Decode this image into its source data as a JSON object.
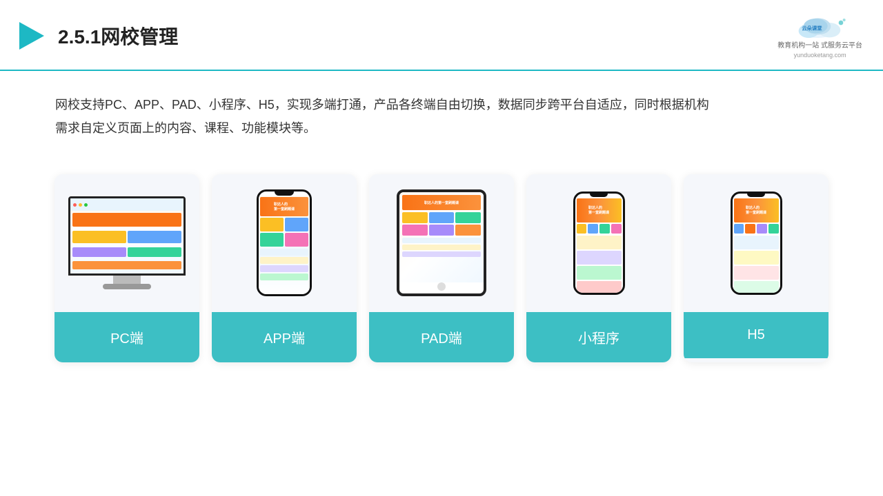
{
  "header": {
    "title": "2.5.1网校管理",
    "logo_name": "云朵课堂",
    "logo_sub": "教育机构一站\n式服务云平台",
    "logo_url": "yunduoketang.com"
  },
  "description": {
    "text": "网校支持PC、APP、PAD、小程序、H5，实现多端打通，产品各终端自由切换，数据同步跨平台自适应，同时根据机构需求自定义页面上的内容、课程、功能模块等。"
  },
  "cards": [
    {
      "id": "pc",
      "label": "PC端",
      "device": "monitor"
    },
    {
      "id": "app",
      "label": "APP端",
      "device": "phone"
    },
    {
      "id": "pad",
      "label": "PAD端",
      "device": "tablet"
    },
    {
      "id": "mini",
      "label": "小程序",
      "device": "phone-tall"
    },
    {
      "id": "h5",
      "label": "H5",
      "device": "phone-tall"
    }
  ],
  "colors": {
    "accent": "#3dbfc4",
    "title": "#222222",
    "text": "#333333",
    "border": "#1db8c4"
  }
}
